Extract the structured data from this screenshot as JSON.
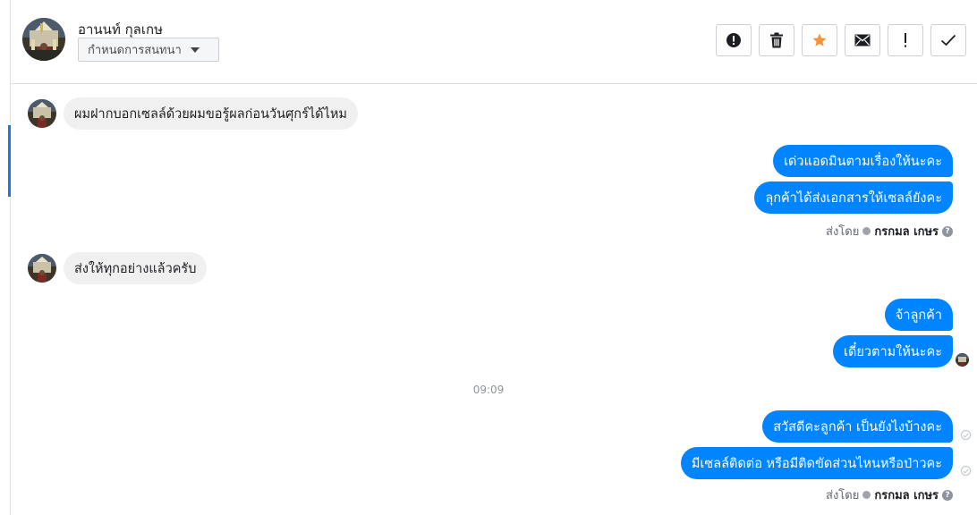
{
  "contact": {
    "name": "อานนท์ กุลเกษ",
    "assign_label": "กำหนดการสนทนา"
  },
  "toolbar": {
    "buttons": [
      {
        "name": "spam-button",
        "icon": "alert-circle-icon"
      },
      {
        "name": "delete-button",
        "icon": "trash-icon"
      },
      {
        "name": "star-button",
        "icon": "star-icon",
        "color": "#f7923b"
      },
      {
        "name": "unread-button",
        "icon": "envelope-icon"
      },
      {
        "name": "follow-up-button",
        "icon": "exclamation-icon"
      },
      {
        "name": "done-button",
        "icon": "check-icon"
      }
    ]
  },
  "messages": [
    {
      "direction": "in",
      "text": "ผมฝากบอกเซลล์ด้วยผมขอรู้ผลก่อนวันศุกร์ได้ไหม"
    },
    {
      "direction": "out",
      "text": "เด่วแอดมินตามเรื่องให้นะคะ"
    },
    {
      "direction": "out",
      "text": "ลุกค้าได้ส่งเอกสารให้เซลล์ยังคะ"
    },
    {
      "direction": "in",
      "text": "ส่งให้ทุกอย่างแล้วครับ"
    },
    {
      "direction": "out",
      "text": "จ้าลูกค้า"
    },
    {
      "direction": "out",
      "text": "เดี๋ยวตามให้นะคะ"
    },
    {
      "direction": "out",
      "text": "สวัสดีคะลูกค้า เป็นยังไงบ้างคะ"
    },
    {
      "direction": "out",
      "text": "มีเซลล์ติดต่อ หรือมีติดขัดส่วนไหนหรือป่าวคะ"
    }
  ],
  "sent_by": {
    "prefix": "ส่งโดย",
    "agent": "กรกมล เกษร",
    "help": "?"
  },
  "timestamp": "09:09",
  "colors": {
    "outgoing_bubble": "#0084ff",
    "incoming_bubble": "#f1f0f0",
    "accent": "#1877f2"
  }
}
